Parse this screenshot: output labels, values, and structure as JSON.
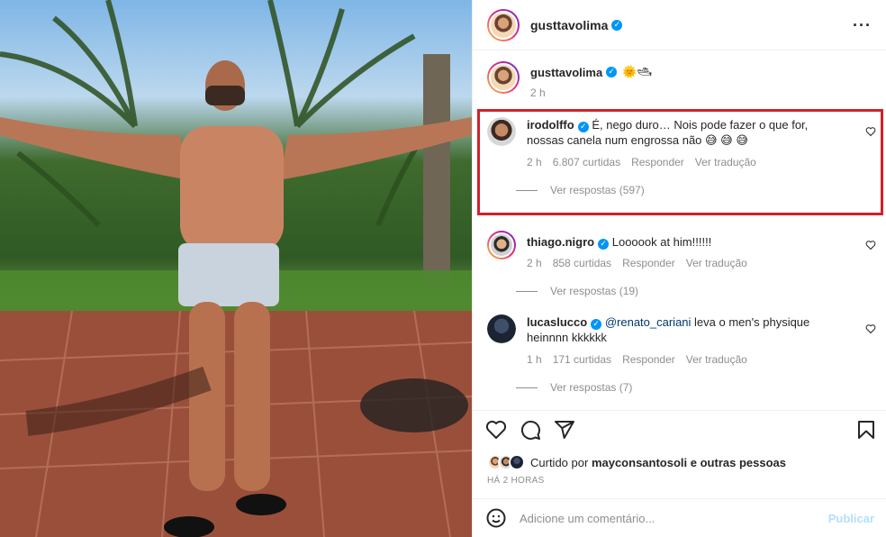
{
  "header": {
    "username": "gusttavolima",
    "more_icon": "more-horizontal-icon"
  },
  "caption": {
    "username": "gusttavolima",
    "emoji": "🌞🛥",
    "timestamp": "2 h"
  },
  "comments": [
    {
      "username": "irodolffo",
      "text": "É, nego duro… Nois pode fazer o que for, nossas canela num engrossa não 😅 😅 😅",
      "time": "2 h",
      "likes": "6.807 curtidas",
      "reply_label": "Responder",
      "translate_label": "Ver tradução",
      "replies_label": "Ver respostas (597)"
    },
    {
      "username": "thiago.nigro",
      "text": "Loooook at him!!!!!!",
      "time": "2 h",
      "likes": "858 curtidas",
      "reply_label": "Responder",
      "translate_label": "Ver tradução",
      "replies_label": "Ver respostas (19)"
    },
    {
      "username": "lucaslucco",
      "mention": "@renato_cariani",
      "text": "leva o men's physique heinnnn kkkkkk",
      "time": "1 h",
      "likes": "171 curtidas",
      "reply_label": "Responder",
      "translate_label": "Ver tradução",
      "replies_label": "Ver respostas (7)"
    }
  ],
  "liked_by": {
    "prefix": "Curtido por",
    "user": "mayconsantosoli",
    "suffix": "e outras pessoas"
  },
  "post_time": "HÁ 2 HORAS",
  "add_comment": {
    "placeholder": "Adicione um comentário...",
    "publish_label": "Publicar"
  },
  "colors": {
    "accent": "#0095f6",
    "highlight": "#d1212a",
    "muted": "#8e8e8e"
  }
}
